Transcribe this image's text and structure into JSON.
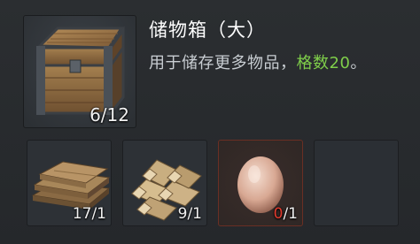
{
  "item": {
    "icon": "wooden-storage-chest-icon",
    "count": "6/12",
    "title": "储物箱（大）",
    "description_prefix": "用于储存更多物品，",
    "description_highlight": "格数20",
    "description_suffix": "。"
  },
  "ingredients": [
    {
      "icon": "wood-planks-icon",
      "have": "17",
      "need": "/1",
      "sufficient": true
    },
    {
      "icon": "firewood-logs-icon",
      "have": "9",
      "need": "/1",
      "sufficient": true
    },
    {
      "icon": "egg-icon",
      "have": "0",
      "need": "/1",
      "sufficient": false
    },
    {
      "icon": "empty-slot",
      "have": "",
      "need": ""
    }
  ],
  "colors": {
    "highlight": "#7fce4a",
    "insufficient": "#e23b2e",
    "text": "#c9ced3"
  }
}
